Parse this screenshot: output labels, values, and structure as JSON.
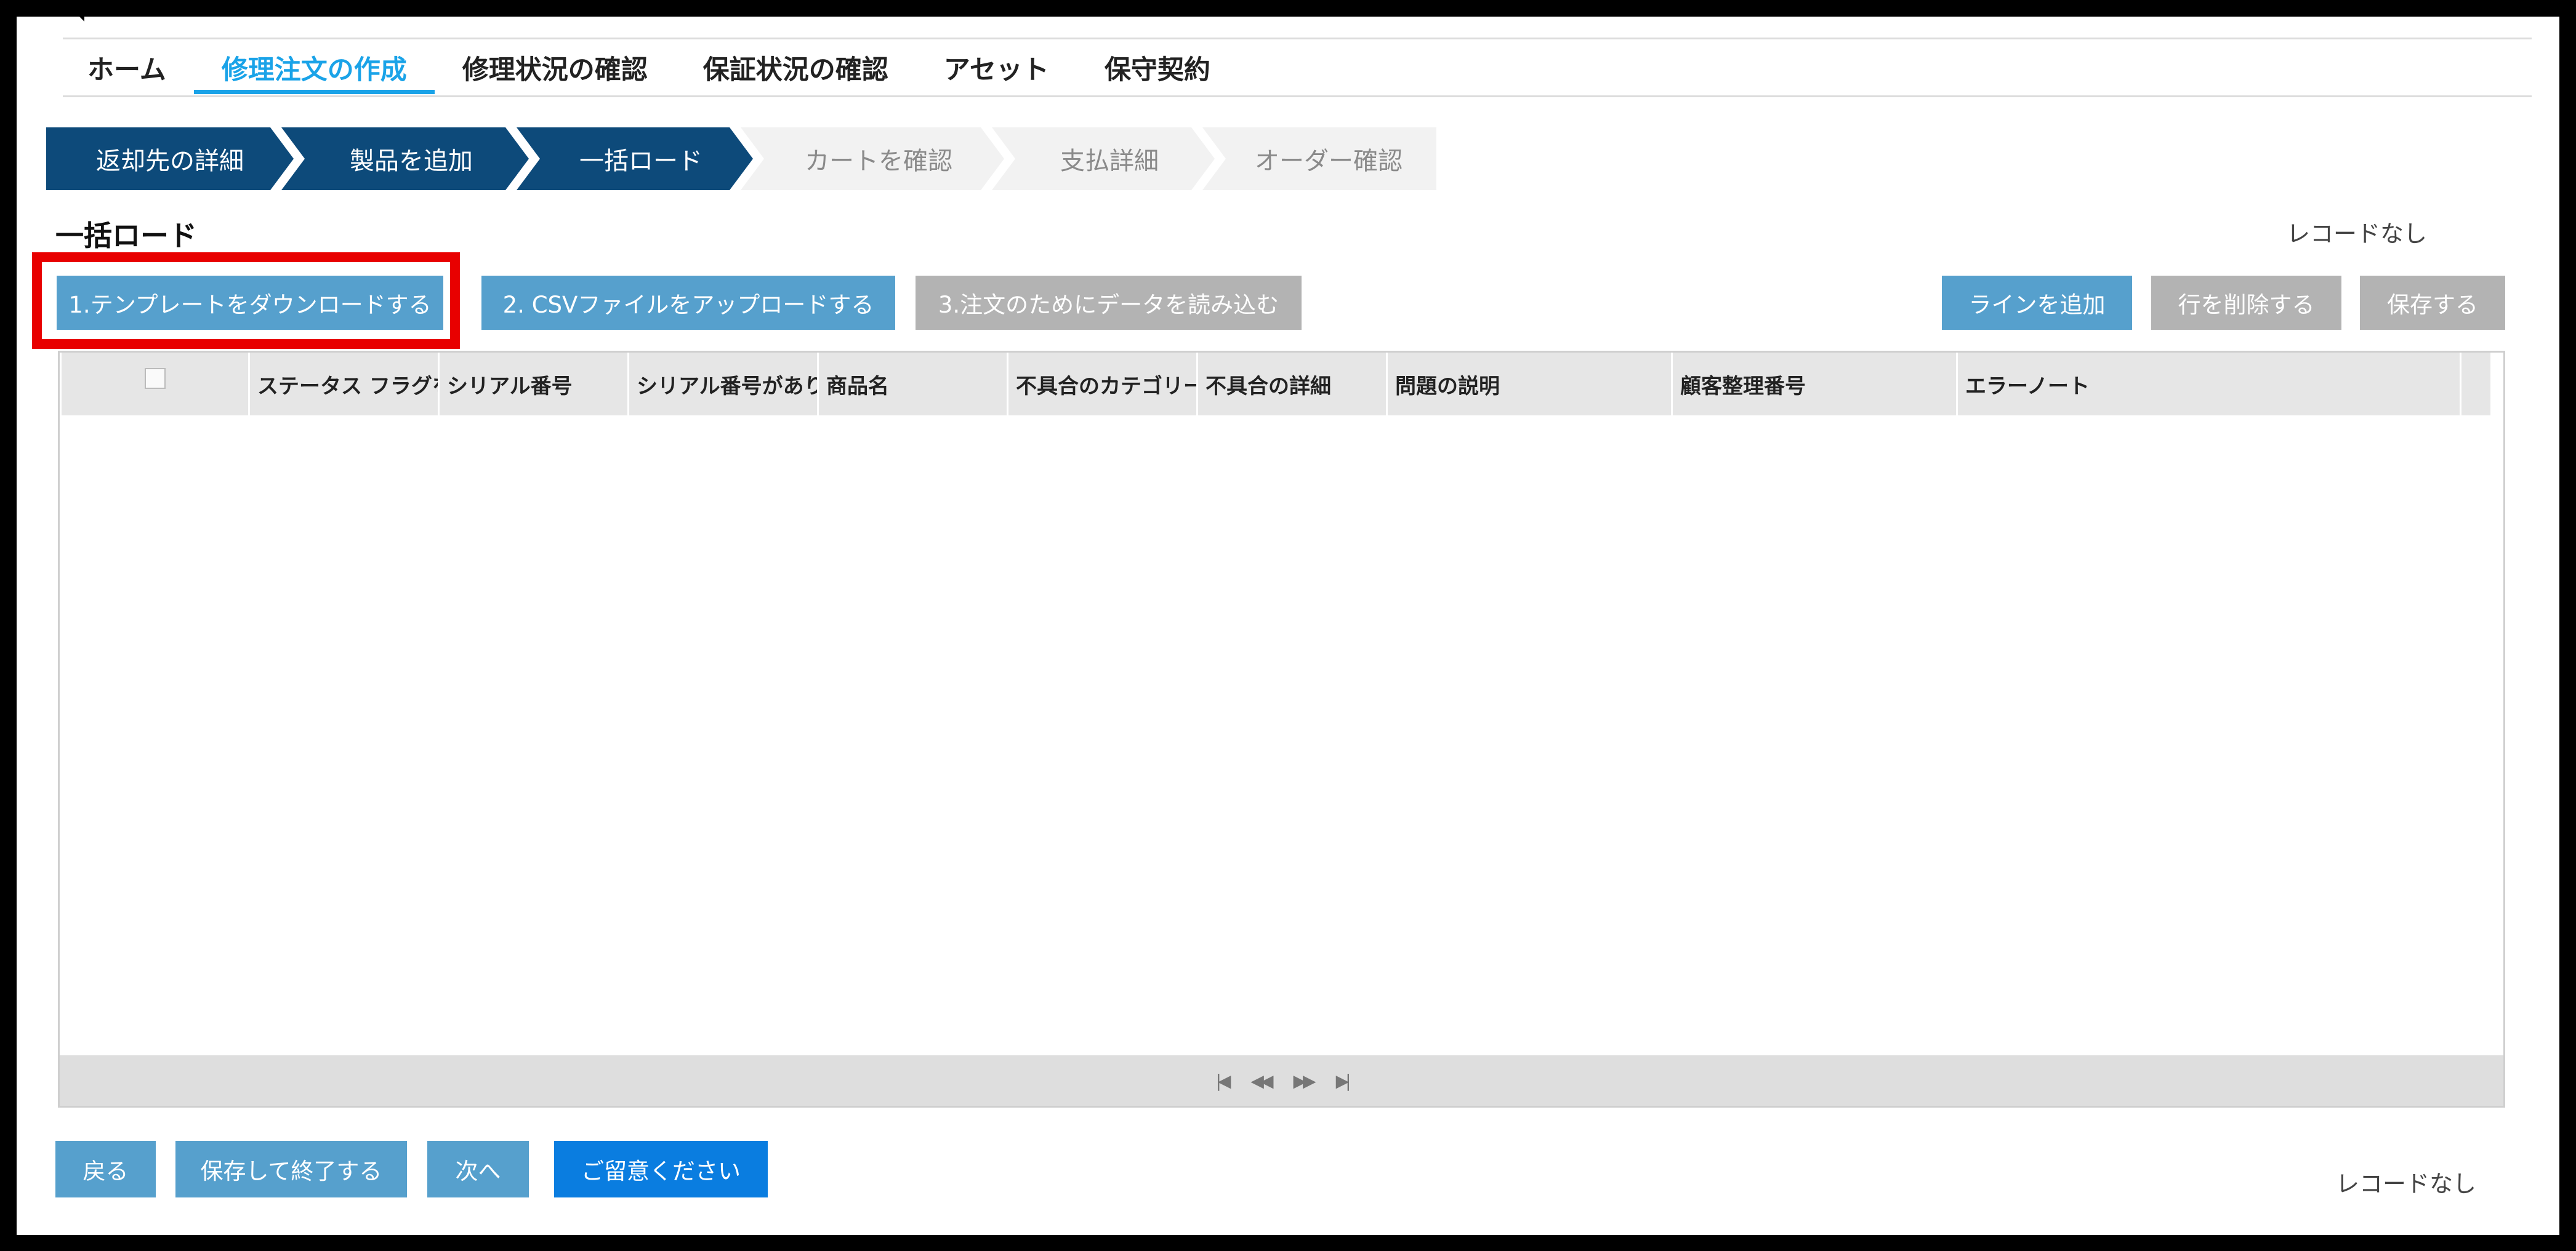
{
  "nav": {
    "items": [
      {
        "label": "ホーム"
      },
      {
        "label": "修理注文の作成"
      },
      {
        "label": "修理状況の確認"
      },
      {
        "label": "保証状況の確認"
      },
      {
        "label": "アセット"
      },
      {
        "label": "保守契約"
      }
    ],
    "active_index": 1
  },
  "stepper": {
    "steps": [
      {
        "label": "返却先の詳細",
        "state": "done"
      },
      {
        "label": "製品を追加",
        "state": "done"
      },
      {
        "label": "一括ロード",
        "state": "current"
      },
      {
        "label": "カートを確認",
        "state": "todo"
      },
      {
        "label": "支払詳細",
        "state": "todo"
      },
      {
        "label": "オーダー確認",
        "state": "todo"
      }
    ]
  },
  "section": {
    "title": "一括ロード",
    "record_status_top": "レコードなし"
  },
  "toolbar": {
    "download_template": "1.テンプレートをダウンロードする",
    "upload_csv": "2. CSVファイルをアップロードする",
    "load_data": "3.注文のためにデータを読み込む",
    "add_line": "ラインを追加",
    "delete_row": "行を削除する",
    "save": "保存する"
  },
  "grid": {
    "columns": [
      "",
      "ステータス フラグを",
      "シリアル番号",
      "シリアル番号があり",
      "商品名",
      "不具合のカテゴリー",
      "不具合の詳細",
      "問題の説明",
      "顧客整理番号",
      "エラーノート"
    ],
    "rows": []
  },
  "footer": {
    "back": "戻る",
    "save_exit": "保存して終了する",
    "next": "次へ",
    "notice": "ご留意ください",
    "record_status_bottom": "レコードなし"
  },
  "colors": {
    "nav_active": "#1aa3e8",
    "step_done": "#0d4a7a",
    "step_todo": "#f2f2f2",
    "button_blue": "#56a0cd",
    "button_disabled": "#b3b3b3",
    "button_primary": "#0a7de0",
    "highlight": "#e80000"
  }
}
